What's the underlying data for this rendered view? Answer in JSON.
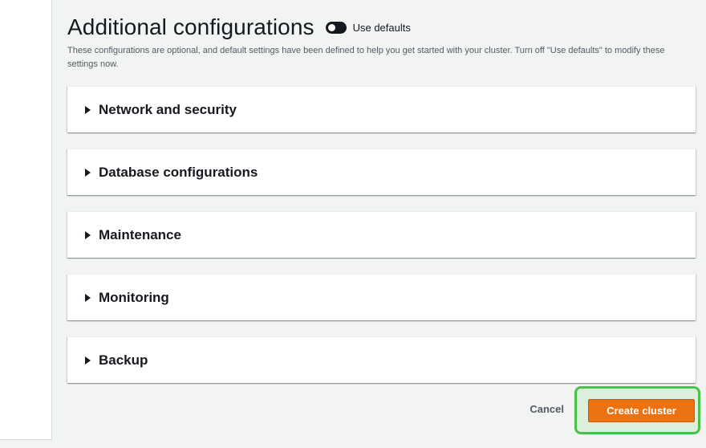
{
  "header": {
    "title": "Additional configurations",
    "toggle_label": "Use defaults",
    "description": "These configurations are optional, and default settings have been defined to help you get started with your cluster. Turn off \"Use defaults\" to modify these settings now."
  },
  "sections": [
    {
      "label": "Network and security"
    },
    {
      "label": "Database configurations"
    },
    {
      "label": "Maintenance"
    },
    {
      "label": "Monitoring"
    },
    {
      "label": "Backup"
    }
  ],
  "footer": {
    "cancel_label": "Cancel",
    "create_label": "Create cluster"
  },
  "colors": {
    "primary_button": "#ec7211",
    "highlight": "#4ac24a"
  },
  "icons": {
    "section_toggle": "caret-right-icon"
  }
}
